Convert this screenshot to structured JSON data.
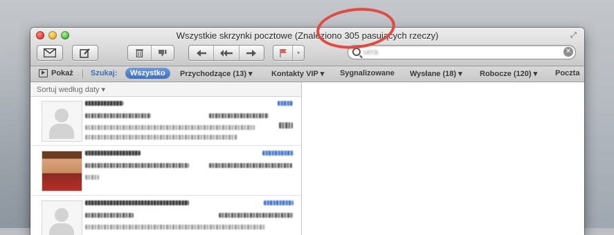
{
  "window": {
    "title": "Wszystkie skrzynki pocztowe (Znaleziono 305 pasujących rzeczy)"
  },
  "toolbar": {
    "get_mail_icon": "envelope-icon",
    "compose_icon": "compose-icon",
    "delete_icon": "trash-icon",
    "junk_icon": "thumbs-down-icon",
    "reply_icon": "reply-icon",
    "reply_all_icon": "reply-all-icon",
    "forward_icon": "forward-icon",
    "flag_icon": "flag-icon"
  },
  "search": {
    "value": "urra",
    "clear_icon": "clear-icon"
  },
  "favorites_bar": {
    "show_label": "Pokaż",
    "search_label": "Szukaj:",
    "scopes": [
      {
        "label": "Wszystko",
        "selected": true
      },
      {
        "label": "Przychodzące (13) ▾"
      },
      {
        "label": "Kontakty VIP ▾"
      },
      {
        "label": "Sygnalizowane"
      },
      {
        "label": "Wysłane (18) ▾"
      },
      {
        "label": "Robocze (120) ▾"
      },
      {
        "label": "Poczta"
      }
    ]
  },
  "message_list": {
    "sort_label": "Sortuj według daty ▾",
    "messages": [
      {
        "avatar": "person-placeholder-icon",
        "sender_visible": false
      },
      {
        "avatar": "contact-photo",
        "sender_visible": false
      },
      {
        "avatar": "person-placeholder-icon",
        "sender_visible": false
      }
    ]
  },
  "annotation": {
    "color": "#e04a42"
  }
}
